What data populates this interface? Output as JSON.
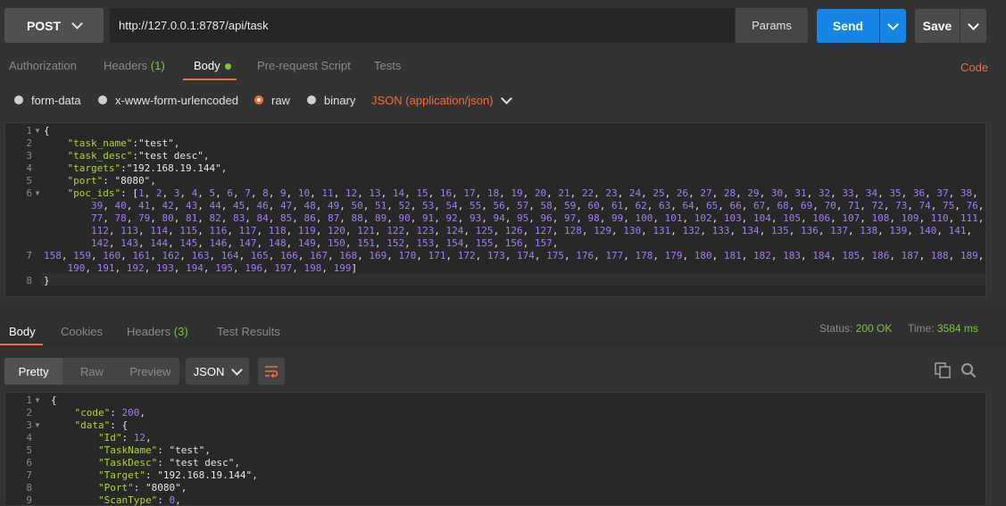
{
  "request": {
    "method": "POST",
    "url": "http://127.0.0.1:8787/api/task",
    "params_label": "Params",
    "send_label": "Send",
    "save_label": "Save"
  },
  "request_tabs": {
    "authorization": "Authorization",
    "headers": "Headers",
    "headers_count": "(1)",
    "body": "Body",
    "prescript": "Pre-request Script",
    "tests": "Tests",
    "code": "Code"
  },
  "body_modes": {
    "form_data": "form-data",
    "urlencoded": "x-www-form-urlencoded",
    "raw": "raw",
    "binary": "binary",
    "content_type": "JSON (application/json)",
    "selected": "raw"
  },
  "request_body": {
    "line_numbers": [
      "1",
      "2",
      "3",
      "4",
      "5",
      "6",
      "7",
      "8"
    ],
    "lines": [
      "{",
      "    \"task_name\":\"test\",",
      "    \"task_desc\":\"test desc\",",
      "    \"targets\":\"192.168.19.144\",",
      "    \"port\": \"8080\",",
      "    \"poc_ids\": [1, 2, 3, 4, 5, 6, 7, 8, 9, 10, 11, 12, 13, 14, 15, 16, 17, 18, 19, 20, 21, 22, 23, 24, 25, 26, 27, 28, 29, 30, 31, 32, 33, 34, 35, 36, 37, 38,",
      "        39, 40, 41, 42, 43, 44, 45, 46, 47, 48, 49, 50, 51, 52, 53, 54, 55, 56, 57, 58, 59, 60, 61, 62, 63, 64, 65, 66, 67, 68, 69, 70, 71, 72, 73, 74, 75, 76,",
      "        77, 78, 79, 80, 81, 82, 83, 84, 85, 86, 87, 88, 89, 90, 91, 92, 93, 94, 95, 96, 97, 98, 99, 100, 101, 102, 103, 104, 105, 106, 107, 108, 109, 110, 111,",
      "        112, 113, 114, 115, 116, 117, 118, 119, 120, 121, 122, 123, 124, 125, 126, 127, 128, 129, 130, 131, 132, 133, 134, 135, 136, 137, 138, 139, 140, 141,",
      "        142, 143, 144, 145, 146, 147, 148, 149, 150, 151, 152, 153, 154, 155, 156, 157,",
      "158, 159, 160, 161, 162, 163, 164, 165, 166, 167, 168, 169, 170, 171, 172, 173, 174, 175, 176, 177, 178, 179, 180, 181, 182, 183, 184, 185, 186, 187, 188, 189,",
      "    190, 191, 192, 193, 194, 195, 196, 197, 198, 199]",
      "}"
    ]
  },
  "response_tabs": {
    "body": "Body",
    "cookies": "Cookies",
    "headers": "Headers",
    "headers_count": "(3)",
    "test_results": "Test Results"
  },
  "response_status": {
    "status_label": "Status:",
    "status_value": "200 OK",
    "time_label": "Time:",
    "time_value": "3584 ms"
  },
  "response_view": {
    "pretty": "Pretty",
    "raw": "Raw",
    "preview": "Preview",
    "format": "JSON"
  },
  "response_body": {
    "line_numbers": [
      "1",
      "2",
      "3",
      "4",
      "5",
      "6",
      "7",
      "8",
      "9"
    ],
    "lines": [
      "{",
      "    \"code\": 200,",
      "    \"data\": {",
      "        \"Id\": 12,",
      "        \"TaskName\": \"test\",",
      "        \"TaskDesc\": \"test desc\",",
      "        \"Target\": \"192.168.19.144\",",
      "        \"Port\": \"8080\",",
      "        \"ScanType\": 0,"
    ]
  },
  "colors": {
    "accent": "#f26b3a",
    "send": "#1785e6",
    "key": "#b5d334",
    "number": "#a37cf5",
    "success": "#7ec443"
  }
}
